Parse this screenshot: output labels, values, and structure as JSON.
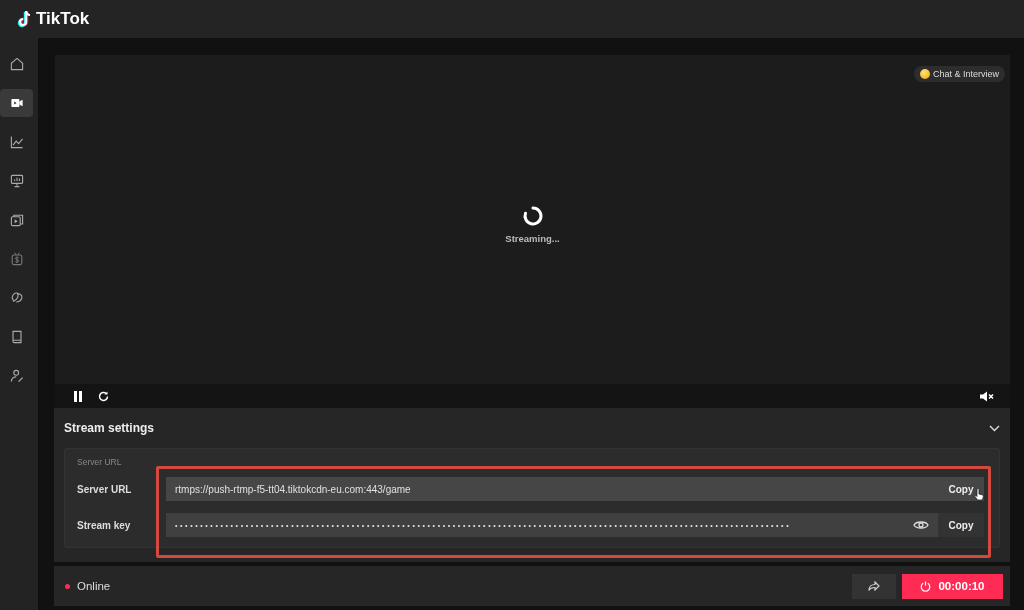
{
  "app": {
    "logo_text": "TikTok"
  },
  "sidebar": {
    "items": [
      {
        "selected": false
      },
      {
        "selected": true
      },
      {
        "selected": false
      },
      {
        "selected": false
      },
      {
        "selected": false
      },
      {
        "selected": false
      },
      {
        "selected": false
      },
      {
        "selected": false
      },
      {
        "selected": false
      }
    ]
  },
  "preview": {
    "badge": "Chat & Interview",
    "status": "Streaming..."
  },
  "stream_settings": {
    "title": "Stream settings",
    "expanded": true,
    "section_label": "Server URL",
    "fields": [
      {
        "label": "Server URL",
        "value": "rtmps://push-rtmp-f5-tt04.tiktokcdn-eu.com:443/game",
        "masked": false,
        "action": "Copy",
        "hovered": true
      },
      {
        "label": "Stream key",
        "value": "••••••••••••••••••••••••••••••••••••••••••••••••••••••••••••••••••••••••••••••••••••••••••••••••••••••••••••••••••••••••••",
        "masked": true,
        "action": "Copy",
        "hovered": false
      }
    ]
  },
  "footer": {
    "status": "Online",
    "timer": "00:00:10"
  }
}
